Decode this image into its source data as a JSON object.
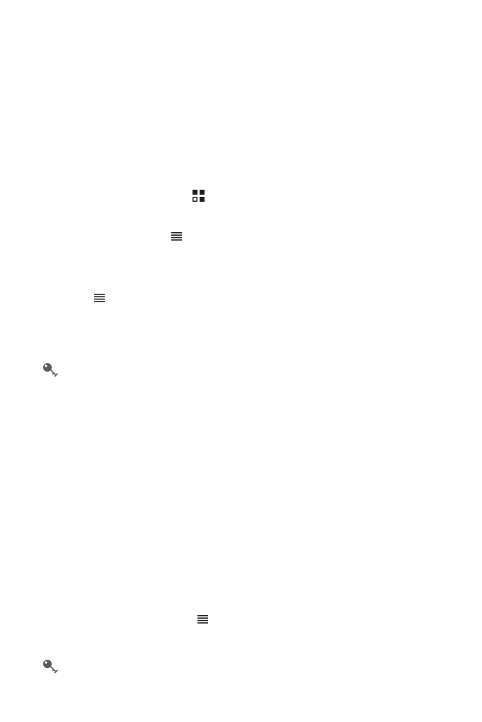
{
  "page": {
    "background": "#ffffff"
  },
  "icons": [
    {
      "name": "apps-grid-icon",
      "color": "#1f1f1f"
    },
    {
      "name": "menu-icon",
      "color": "#1f1f1f"
    },
    {
      "name": "menu-icon",
      "color": "#1f1f1f"
    },
    {
      "name": "key-icon",
      "color": "#5a5a5a"
    },
    {
      "name": "menu-icon",
      "color": "#1f1f1f"
    },
    {
      "name": "key-icon",
      "color": "#5a5a5a"
    }
  ]
}
